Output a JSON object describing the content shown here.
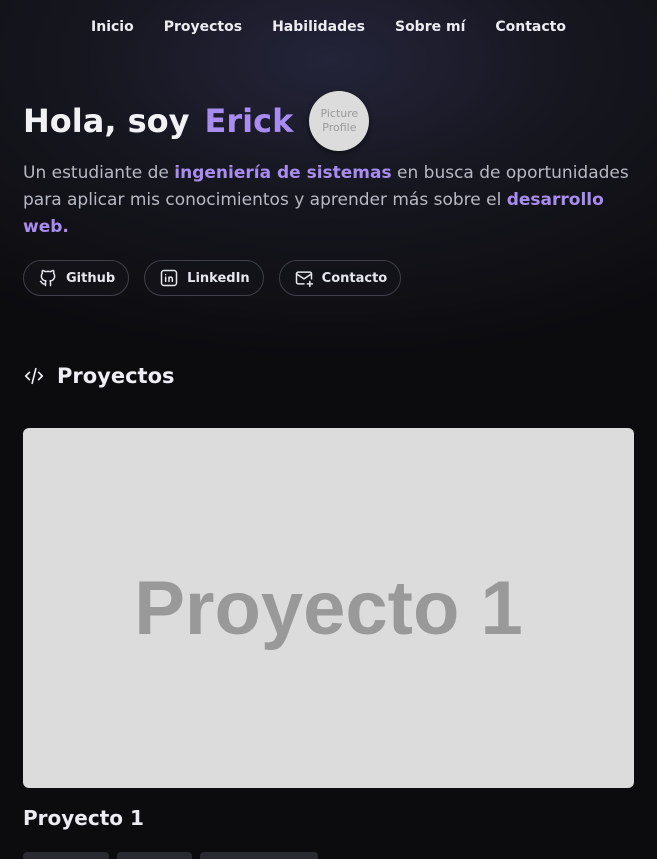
{
  "nav": {
    "items": [
      {
        "label": "Inicio"
      },
      {
        "label": "Proyectos"
      },
      {
        "label": "Habilidades"
      },
      {
        "label": "Sobre mí"
      },
      {
        "label": "Contacto"
      }
    ]
  },
  "hero": {
    "greeting": "Hola, soy",
    "name": "Erick",
    "avatar_line1": "Picture",
    "avatar_line2": "Profile",
    "intro_part1": "Un estudiante de ",
    "intro_highlight1": "ingeniería de sistemas",
    "intro_part2": " en busca de oportunidades para aplicar mis conocimientos y aprender más sobre el ",
    "intro_highlight2": "desarrollo web."
  },
  "socials": [
    {
      "label": "Github",
      "icon": "github-icon"
    },
    {
      "label": "LinkedIn",
      "icon": "linkedin-icon"
    },
    {
      "label": "Contacto",
      "icon": "mail-icon"
    }
  ],
  "projects_section": {
    "title": "Proyectos",
    "icon": "code-icon",
    "items": [
      {
        "image_text": "Proyecto 1",
        "name": "Proyecto 1"
      }
    ]
  },
  "colors": {
    "accent": "#a98cf0",
    "background": "#0c0c0f",
    "placeholder": "#dcdcdc"
  }
}
